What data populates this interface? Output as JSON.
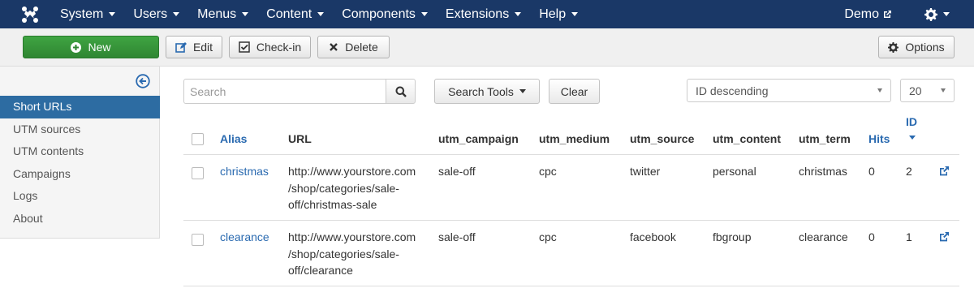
{
  "navbar": {
    "logo_icon": "joomla-logo-icon",
    "menu": [
      "System",
      "Users",
      "Menus",
      "Content",
      "Components",
      "Extensions",
      "Help"
    ],
    "user_label": "Demo",
    "colors": {
      "background": "#1a3867"
    }
  },
  "toolbar": {
    "new_label": "New",
    "edit_label": "Edit",
    "checkin_label": "Check-in",
    "delete_label": "Delete",
    "options_label": "Options",
    "colors": {
      "new_button": "#3fa442"
    }
  },
  "sidebar": {
    "items": [
      {
        "label": "Short URLs",
        "active": true
      },
      {
        "label": "UTM sources",
        "active": false
      },
      {
        "label": "UTM contents",
        "active": false
      },
      {
        "label": "Campaigns",
        "active": false
      },
      {
        "label": "Logs",
        "active": false
      },
      {
        "label": "About",
        "active": false
      }
    ],
    "colors": {
      "active": "#2d6ca2"
    }
  },
  "filters": {
    "search_placeholder": "Search",
    "search_value": "",
    "search_tools_label": "Search Tools",
    "clear_label": "Clear",
    "ordering_value": "ID descending",
    "limit_value": "20"
  },
  "table": {
    "headers": {
      "alias": "Alias",
      "url": "URL",
      "utm_campaign": "utm_campaign",
      "utm_medium": "utm_medium",
      "utm_source": "utm_source",
      "utm_content": "utm_content",
      "utm_term": "utm_term",
      "hits": "Hits",
      "id": "ID"
    },
    "rows": [
      {
        "alias": "christmas",
        "url_lines": [
          "http://www.yourstore.com",
          "/shop/categories/sale-",
          "off/christmas-sale"
        ],
        "utm_campaign": "sale-off",
        "utm_medium": "cpc",
        "utm_source": "twitter",
        "utm_content": "personal",
        "utm_term": "christmas",
        "hits": "0",
        "id": "2"
      },
      {
        "alias": "clearance",
        "url_lines": [
          "http://www.yourstore.com",
          "/shop/categories/sale-",
          "off/clearance"
        ],
        "utm_campaign": "sale-off",
        "utm_medium": "cpc",
        "utm_source": "facebook",
        "utm_content": "fbgroup",
        "utm_term": "clearance",
        "hits": "0",
        "id": "1"
      }
    ],
    "colors": {
      "link": "#2a6ab0"
    }
  }
}
